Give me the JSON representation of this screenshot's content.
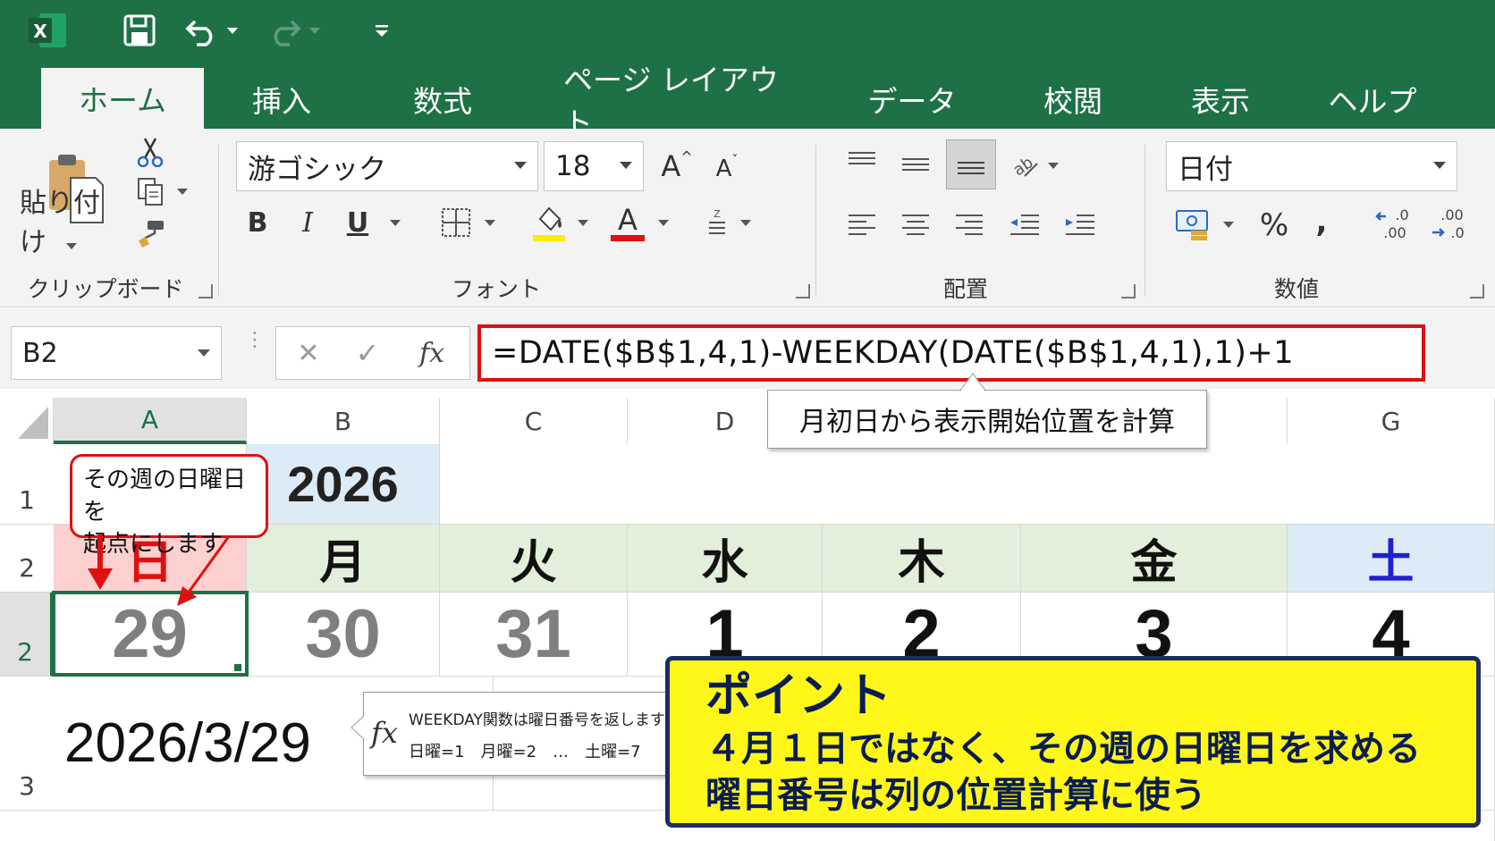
{
  "app": {
    "logo_letter": "X"
  },
  "quick_access": {
    "icons": [
      "save-icon",
      "undo-icon",
      "redo-icon",
      "customize-icon"
    ]
  },
  "tabs": [
    {
      "label": "ホーム",
      "active": true
    },
    {
      "label": "挿入"
    },
    {
      "label": "数式"
    },
    {
      "label": "ページ レイアウト"
    },
    {
      "label": "データ"
    },
    {
      "label": "校閲"
    },
    {
      "label": "表示"
    },
    {
      "label": "ヘルプ"
    }
  ],
  "ribbon": {
    "clipboard": {
      "paste_label": "貼り付け",
      "group_label": "クリップボード"
    },
    "font": {
      "font_name": "游ゴシック",
      "font_size": "18",
      "grow_label": "A",
      "shrink_label": "A",
      "bold": "B",
      "italic": "I",
      "underline": "U",
      "font_color_letter": "A",
      "group_label": "フォント",
      "fill_color": "#ffec00",
      "font_color": "#e01010"
    },
    "alignment": {
      "group_label": "配置"
    },
    "number": {
      "format": "日付",
      "percent": "%",
      "comma": ",",
      "group_label": "数値"
    }
  },
  "formula_bar": {
    "name_box": "B2",
    "cancel": "✕",
    "enter": "✓",
    "fx": "fx",
    "formula": "=DATE($B$1,4,1)-WEEKDAY(DATE($B$1,4,1),1)+1",
    "tooltip": "月初日から表示開始位置を計算"
  },
  "grid": {
    "columns": [
      "A",
      "B",
      "C",
      "D",
      "E",
      "F",
      "G"
    ],
    "selected_column": "A",
    "row_numbers": [
      "1",
      "2",
      "2",
      "3"
    ],
    "year_cell": "2026",
    "weekdays": [
      "日",
      "月",
      "火",
      "水",
      "木",
      "金",
      "土"
    ],
    "dates": [
      "29",
      "30",
      "31",
      "1",
      "2",
      "3",
      "4"
    ],
    "date_colors": [
      "#7f7f7f",
      "#7f7f7f",
      "#7f7f7f",
      "#111111",
      "#111111",
      "#111111",
      "#111111"
    ],
    "weekday_fills": [
      "#fdd0d0",
      "#e2efda",
      "#e2efda",
      "#e2efda",
      "#e2efda",
      "#e2efda",
      "#ddebf7"
    ],
    "result_value": "2026/3/29"
  },
  "callout_sunday": {
    "line1": "その週の日曜日を",
    "line2": "起点にします"
  },
  "fx_tooltip": {
    "icon": "fx",
    "line1": "WEEKDAY関数は曜日番号を返します",
    "line2": "日曜=1　月曜=2　…　土曜=7"
  },
  "point_box": {
    "title": "ポイント",
    "line1": "４月１日ではなく、その週の日曜日を求める",
    "line2": "曜日番号は列の位置計算に使う"
  },
  "colors": {
    "excel_green": "#1e7145",
    "accent_red": "#e01010",
    "saturday_blue": "#1f1fd8",
    "point_yellow": "#fff71a",
    "point_border": "#1c2c64"
  }
}
